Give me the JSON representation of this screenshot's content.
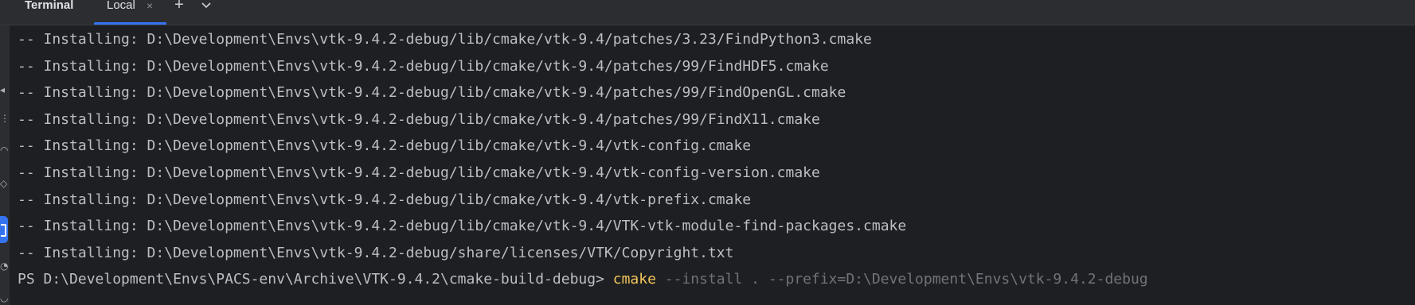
{
  "tool_window": {
    "title": "Terminal"
  },
  "tabs": [
    {
      "label": "Local",
      "close_glyph": "×",
      "active": true
    }
  ],
  "toolbar": {
    "new_tab_glyph": "+",
    "new_tab_icon": "plus-icon",
    "options_icon": "chevron-down-icon"
  },
  "gutter": {
    "icons": [
      "bookmark-icon",
      "structure-icon",
      "commit-icon",
      "terminal-icon",
      "problems-icon"
    ],
    "active_icon": "terminal-icon",
    "accent_color": "#3574f0"
  },
  "output": {
    "lines": [
      "-- Installing: D:\\Development\\Envs\\vtk-9.4.2-debug/lib/cmake/vtk-9.4/patches/3.23/FindPython3.cmake",
      "-- Installing: D:\\Development\\Envs\\vtk-9.4.2-debug/lib/cmake/vtk-9.4/patches/99/FindHDF5.cmake",
      "-- Installing: D:\\Development\\Envs\\vtk-9.4.2-debug/lib/cmake/vtk-9.4/patches/99/FindOpenGL.cmake",
      "-- Installing: D:\\Development\\Envs\\vtk-9.4.2-debug/lib/cmake/vtk-9.4/patches/99/FindX11.cmake",
      "-- Installing: D:\\Development\\Envs\\vtk-9.4.2-debug/lib/cmake/vtk-9.4/vtk-config.cmake",
      "-- Installing: D:\\Development\\Envs\\vtk-9.4.2-debug/lib/cmake/vtk-9.4/vtk-config-version.cmake",
      "-- Installing: D:\\Development\\Envs\\vtk-9.4.2-debug/lib/cmake/vtk-9.4/vtk-prefix.cmake",
      "-- Installing: D:\\Development\\Envs\\vtk-9.4.2-debug/lib/cmake/vtk-9.4/VTK-vtk-module-find-packages.cmake",
      "-- Installing: D:\\Development\\Envs\\vtk-9.4.2-debug/share/licenses/VTK/Copyright.txt"
    ]
  },
  "prompt": {
    "text": "PS D:\\Development\\Envs\\PACS-env\\Archive\\VTK-9.4.2\\cmake-build-debug> ",
    "command": "cmake",
    "suggestion": " --install . --prefix=D:\\Development\\Envs\\vtk-9.4.2-debug",
    "command_color": "#f2c55c",
    "suggestion_color": "#6f737a"
  },
  "colors": {
    "background": "#1e1f22",
    "header_background": "#2b2d30",
    "text": "#bcbec4",
    "accent": "#3574f0"
  }
}
